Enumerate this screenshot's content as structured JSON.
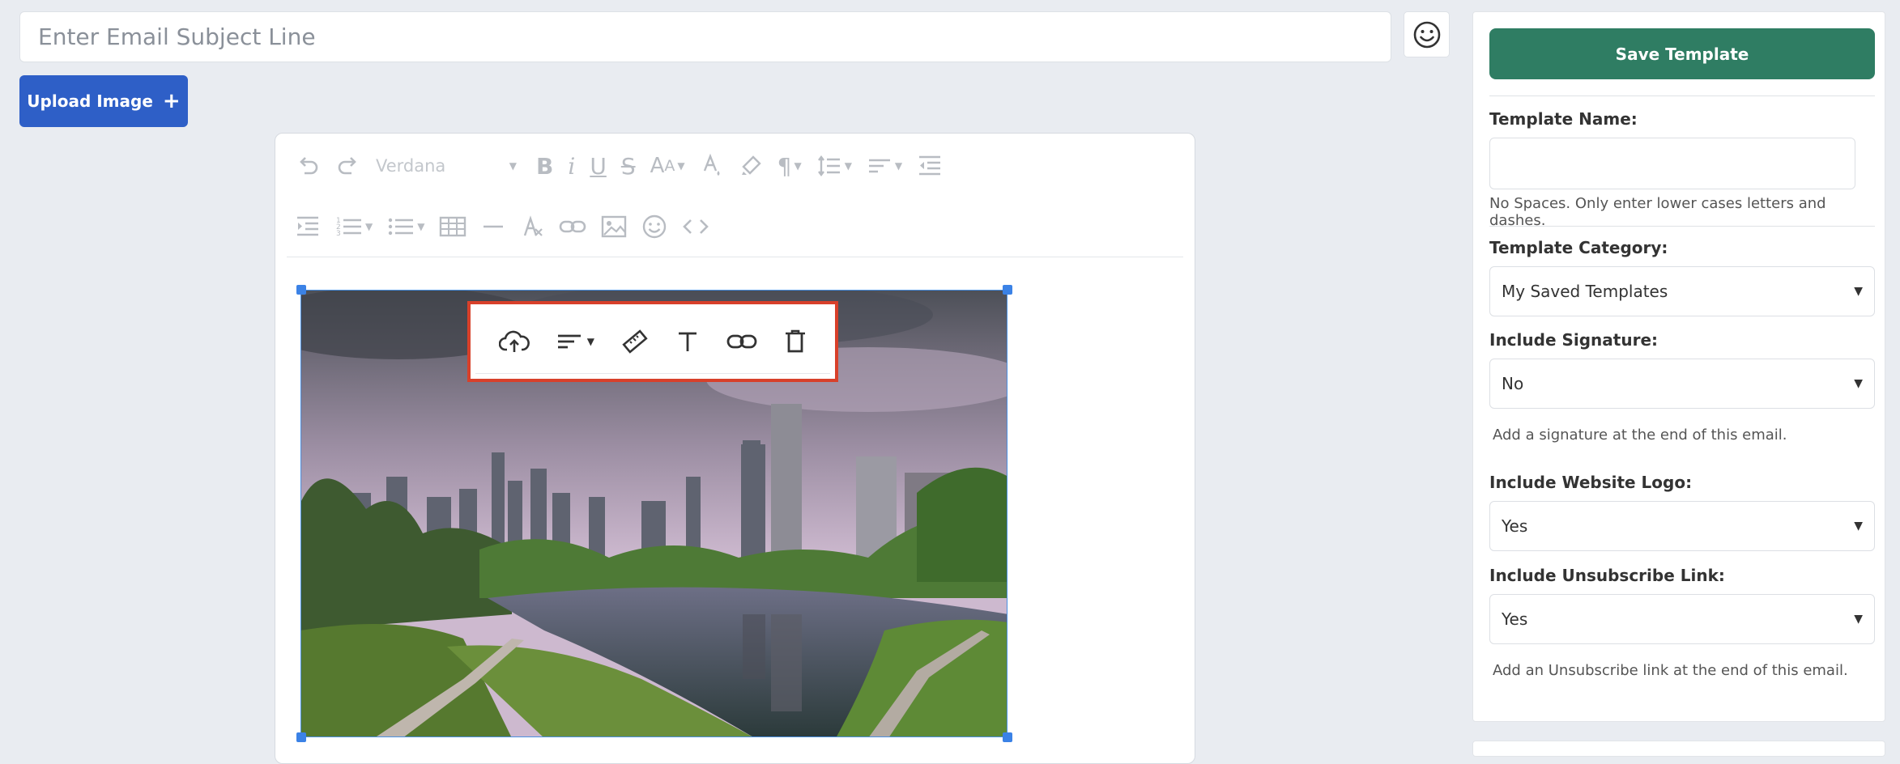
{
  "subject": {
    "placeholder": "Enter Email Subject Line"
  },
  "upload": {
    "label": "Upload Image"
  },
  "editor": {
    "font_family": "Verdana",
    "toolbar_row1": [
      "undo-icon",
      "redo-icon",
      "font-family-select",
      "bold-icon",
      "italic-icon",
      "underline-icon",
      "strikethrough-icon",
      "font-size-icon",
      "text-color-icon",
      "highlight-icon",
      "paragraph-icon",
      "line-height-icon",
      "align-icon",
      "outdent-icon"
    ],
    "toolbar_row2": [
      "indent-icon",
      "ordered-list-icon",
      "unordered-list-icon",
      "table-icon",
      "horizontal-rule-icon",
      "clear-format-icon",
      "link-icon",
      "image-icon",
      "emoji-icon",
      "code-view-icon"
    ]
  },
  "image_toolbar": [
    "upload-cloud-icon",
    "image-align-icon",
    "image-size-icon",
    "alt-text-icon",
    "image-link-icon",
    "delete-icon"
  ],
  "image_toolbar_highlight_color": "#d8402a",
  "panel": {
    "save_label": "Save Template",
    "template_name_label": "Template Name:",
    "template_name_value": "",
    "template_name_help": "No Spaces. Only enter lower cases letters and dashes.",
    "category_label": "Template Category:",
    "category_value": "My Saved Templates",
    "signature_label": "Include Signature:",
    "signature_value": "No",
    "signature_help": "Add a signature at the end of this email.",
    "logo_label": "Include Website Logo:",
    "logo_value": "Yes",
    "unsub_label": "Include Unsubscribe Link:",
    "unsub_value": "Yes",
    "unsub_help": "Add an Unsubscribe link at the end of this email."
  },
  "colors": {
    "primary_button": "#2e5fc7",
    "save_button": "#2f7d63",
    "selection": "#3b82e6"
  }
}
